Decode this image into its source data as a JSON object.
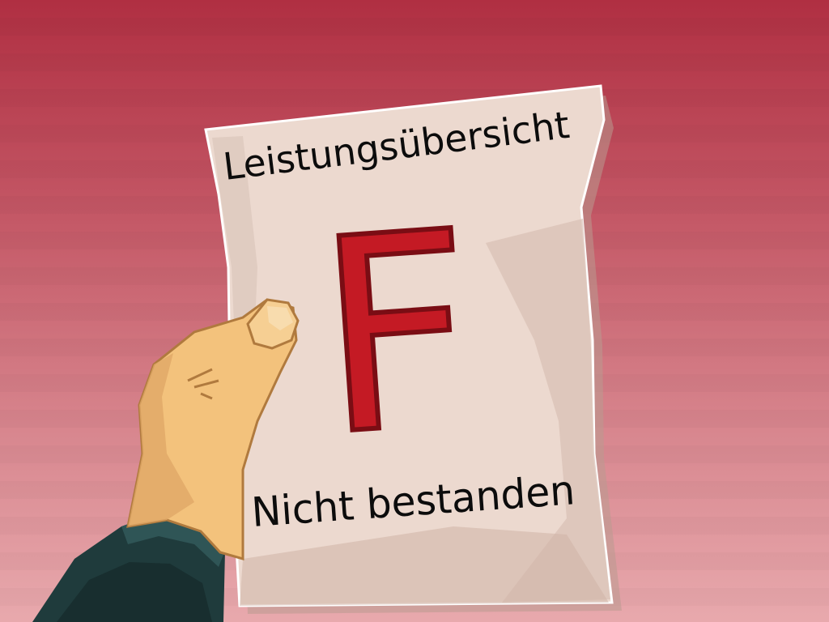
{
  "paper": {
    "title": "Leistungsübersicht",
    "grade": "F",
    "result": "Nicht bestanden"
  },
  "colors": {
    "background_top": "#b02f42",
    "background_bottom": "#e8a9ad",
    "paper": "#ecd9cf",
    "grade_red": "#c41a24",
    "skin": "#f3c27c",
    "sleeve": "#1f3b3c",
    "ink": "#0c0c0c"
  }
}
